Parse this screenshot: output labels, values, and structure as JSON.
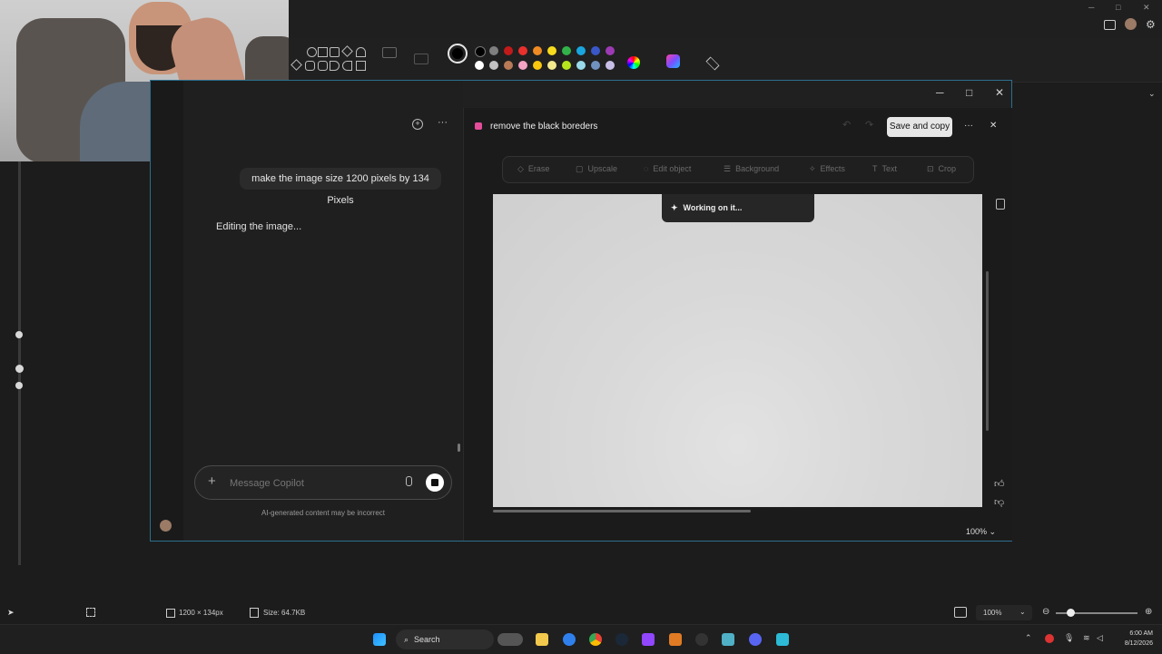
{
  "webcam": {
    "description_hidden": ""
  },
  "copilot": {
    "window_controls": {
      "minimize": "─",
      "maximize": "□",
      "close": "✕"
    },
    "chat": {
      "user_message": "make the image size 1200 pixels by 134 Pixels",
      "assistant_status": "Editing the image...",
      "composer_placeholder": "Message Copilot",
      "add_icon": "+",
      "disclaimer": "AI-generated content may be incorrect"
    },
    "editor": {
      "title": "remove the black boreders",
      "save_copy_label": "Save and copy",
      "more_label": "···",
      "close_label": "✕",
      "tools": [
        "Erase",
        "Upscale",
        "Edit object",
        "Background",
        "Effects",
        "Text",
        "Crop"
      ],
      "working_label": "Working on it...",
      "zoom_label": "100%"
    }
  },
  "statusbar": {
    "dimensions": "1200 × 134px",
    "size": "Size: 64.7KB",
    "zoom": "100%"
  },
  "taskbar": {
    "search_label": "Search",
    "time": "6:00 AM",
    "date": "8/12/2026"
  },
  "colors": {
    "accent_border": "#2c6f8f",
    "save_button": "#e6e6e6"
  }
}
